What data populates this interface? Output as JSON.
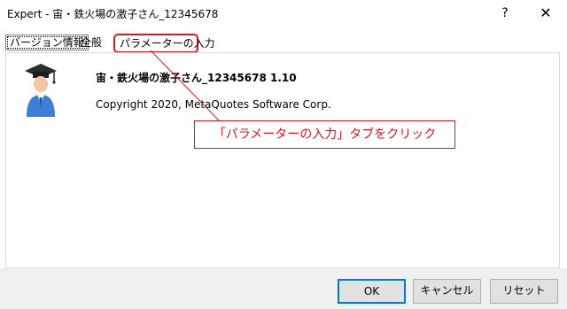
{
  "window": {
    "title": "Expert - 宙・鉄火場の激子さん_12345678",
    "help_label": "?",
    "close_label": "✕"
  },
  "tabs": [
    {
      "label": "バージョン情報"
    },
    {
      "label": "全般"
    },
    {
      "label": "パラメーターの入力"
    }
  ],
  "about": {
    "ea_name": "宙・鉄火場の激子さん_12345678 1.10",
    "copyright": "Copyright 2020, MetaQuotes Software Corp.",
    "icon": "graduate-avatar-icon"
  },
  "annotation": {
    "text": "「パラメーターの入力」タブをクリック",
    "color": "#d2191f"
  },
  "buttons": {
    "ok": "OK",
    "cancel": "キャンセル",
    "reset": "リセット"
  },
  "colors": {
    "accent": "#0078d7",
    "highlight": "#d2191f",
    "footer": "#f0f0f0"
  }
}
